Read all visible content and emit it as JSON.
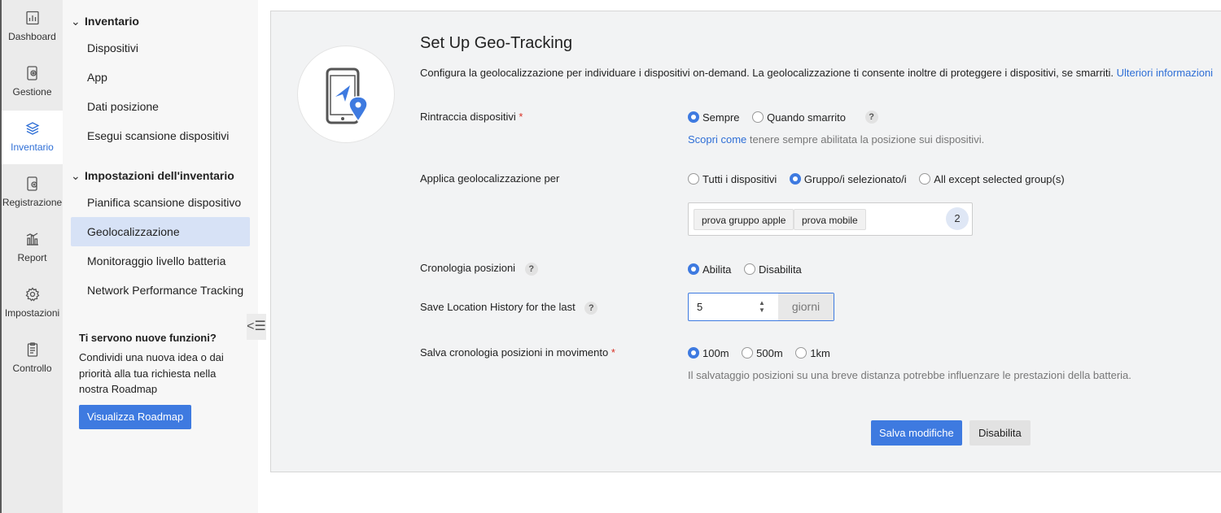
{
  "rail": {
    "items": [
      {
        "label": "Dashboard",
        "icon": "dashboard-icon"
      },
      {
        "label": "Gestione",
        "icon": "management-icon"
      },
      {
        "label": "Inventario",
        "icon": "inventory-layers-icon"
      },
      {
        "label": "Registrazione",
        "icon": "enrollment-icon"
      },
      {
        "label": "Report",
        "icon": "report-chart-icon"
      },
      {
        "label": "Impostazioni",
        "icon": "settings-gear-icon"
      },
      {
        "label": "Controllo",
        "icon": "audit-clipboard-icon"
      }
    ],
    "active": "Inventario"
  },
  "nav": {
    "section1": "Inventario",
    "section1_items": [
      "Dispositivi",
      "App",
      "Dati posizione",
      "Esegui scansione dispositivi"
    ],
    "section2": "Impostazioni dell'inventario",
    "section2_items": [
      "Pianifica scansione dispositivo",
      "Geolocalizzazione",
      "Monitoraggio livello batteria",
      "Network Performance Tracking"
    ],
    "active_item": "Geolocalizzazione",
    "promo": {
      "title": "Ti servono nuove funzioni?",
      "text": "Condividi una nuova idea o dai priorità alla tua richiesta nella nostra Roadmap",
      "button": "Visualizza Roadmap"
    }
  },
  "main": {
    "title": "Set Up Geo-Tracking",
    "description": "Configura la geolocalizzazione per individuare i dispositivi on-demand. La geolocalizzazione ti consente inoltre di proteggere i dispositivi, se smarriti.",
    "description_link": "Ulteriori informazioni",
    "track": {
      "label": "Rintraccia dispositivi",
      "required": "*",
      "options": [
        "Sempre",
        "Quando smarrito"
      ],
      "selected": "Sempre",
      "help": "?",
      "note_link": "Scopri come",
      "note_text": "tenere sempre abilitata la posizione sui dispositivi."
    },
    "apply": {
      "label": "Applica geolocalizzazione per",
      "options": [
        "Tutti i dispositivi",
        "Gruppo/i selezionato/i",
        "All except selected group(s)"
      ],
      "selected": "Gruppo/i selezionato/i",
      "groups": [
        "prova gruppo apple",
        "prova mobile"
      ],
      "group_count": "2"
    },
    "history": {
      "label": "Cronologia posizioni",
      "help": "?",
      "options": [
        "Abilita",
        "Disabilita"
      ],
      "selected": "Abilita"
    },
    "save_for": {
      "label": "Save Location History for the last",
      "help": "?",
      "value": "5",
      "unit": "giorni"
    },
    "movement": {
      "label": "Salva cronologia posizioni in movimento",
      "required": "*",
      "options": [
        "100m",
        "500m",
        "1km"
      ],
      "selected": "100m",
      "note": "Il salvataggio posizioni su una breve distanza potrebbe influenzare le prestazioni della batteria."
    },
    "buttons": {
      "save": "Salva modifiche",
      "disable": "Disabilita"
    }
  },
  "colors": {
    "accent": "#3e7ae0",
    "link": "#2f6fd6",
    "required": "#d93025",
    "active_nav_bg": "#d7e2f6"
  }
}
